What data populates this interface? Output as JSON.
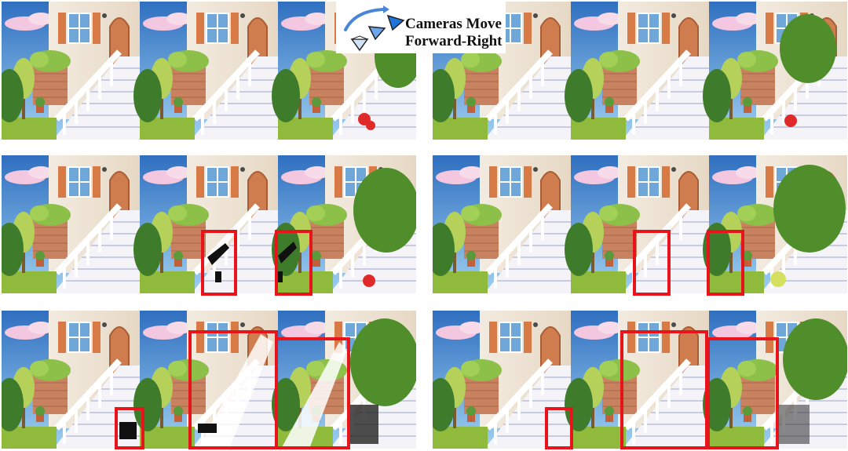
{
  "legend": {
    "line1": "Cameras Move",
    "line2": "Forward-Right",
    "arrow-icon": "curved-arrow-icon",
    "camera-icon": "camera-frustum-icon"
  },
  "colors": {
    "highlight": "#e8141c",
    "sky": "#5fa8e0",
    "wall": "#efe6d8",
    "brick": "#c98260",
    "shutter": "#d87a45",
    "door": "#cf7d4f",
    "stairs": "#f4f3f8",
    "foliage": "#6aa33a",
    "grass": "#8fba3c",
    "artifact": "#111111"
  },
  "layout": {
    "rows": 3,
    "columns": 2,
    "frames_per_strip": 3
  }
}
